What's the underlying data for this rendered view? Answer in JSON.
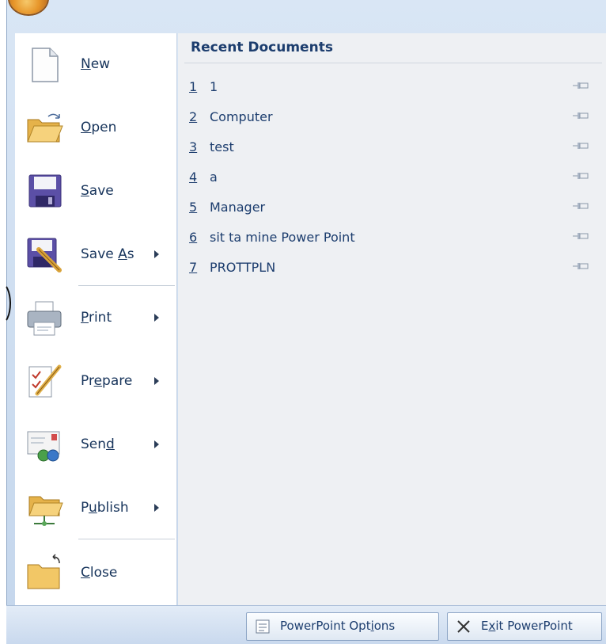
{
  "menu": {
    "commands": [
      {
        "pre": "",
        "key": "N",
        "post": "ew",
        "has_submenu": false
      },
      {
        "pre": "",
        "key": "O",
        "post": "pen",
        "has_submenu": false
      },
      {
        "pre": "",
        "key": "S",
        "post": "ave",
        "has_submenu": false
      },
      {
        "pre": "Save ",
        "key": "A",
        "post": "s",
        "has_submenu": true
      },
      {
        "pre": "",
        "key": "P",
        "post": "rint",
        "has_submenu": true
      },
      {
        "pre": "Pr",
        "key": "e",
        "post": "pare",
        "has_submenu": true
      },
      {
        "pre": "Sen",
        "key": "d",
        "post": "",
        "has_submenu": true
      },
      {
        "pre": "P",
        "key": "u",
        "post": "blish",
        "has_submenu": true
      },
      {
        "pre": "",
        "key": "C",
        "post": "lose",
        "has_submenu": false
      }
    ]
  },
  "recent": {
    "title": "Recent Documents",
    "items": [
      {
        "num": "1",
        "name": "1"
      },
      {
        "num": "2",
        "name": "Computer"
      },
      {
        "num": "3",
        "name": "test"
      },
      {
        "num": "4",
        "name": "a"
      },
      {
        "num": "5",
        "name": "Manager"
      },
      {
        "num": "6",
        "name": "sit ta mine Power Point"
      },
      {
        "num": "7",
        "name": "PROTTPLN"
      }
    ]
  },
  "footer": {
    "options_pre": "PowerPoint Opt",
    "options_key": "i",
    "options_post": "ons",
    "exit_pre": "E",
    "exit_key": "x",
    "exit_post": "it PowerPoint"
  }
}
